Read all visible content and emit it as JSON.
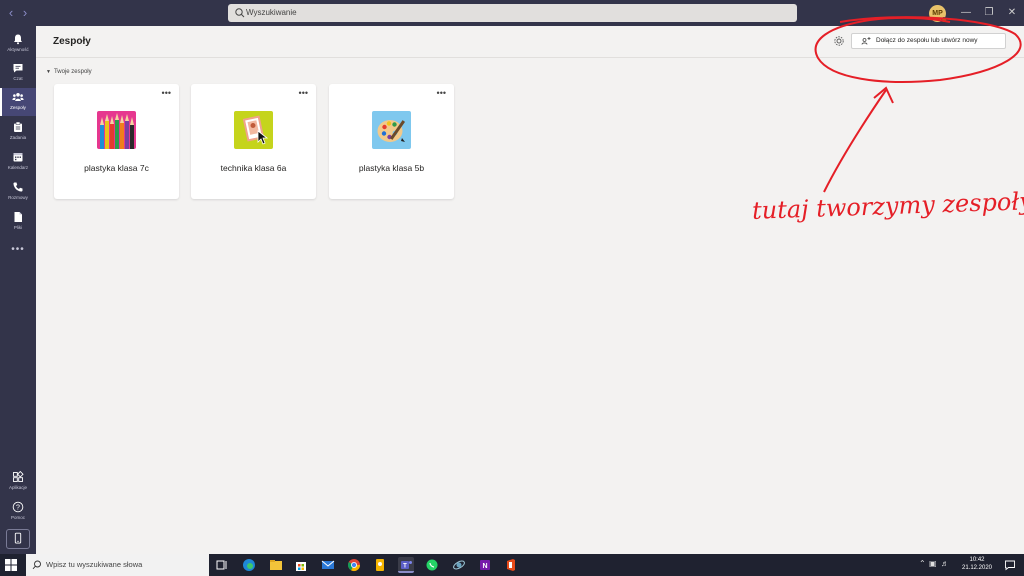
{
  "titlebar": {
    "search_placeholder": "Wyszukiwanie",
    "avatar_initials": "MP"
  },
  "rail": {
    "items": [
      {
        "label": "Aktywność",
        "icon": "bell-icon"
      },
      {
        "label": "Czat",
        "icon": "chat-icon"
      },
      {
        "label": "Zespoły",
        "icon": "teams-icon"
      },
      {
        "label": "Zadania",
        "icon": "assignments-icon"
      },
      {
        "label": "Kalendarz",
        "icon": "calendar-icon"
      },
      {
        "label": "Rozmowy",
        "icon": "phone-icon"
      },
      {
        "label": "Pliki",
        "icon": "files-icon"
      }
    ],
    "bottom": [
      {
        "label": "Aplikacje",
        "icon": "apps-icon"
      },
      {
        "label": "Pomoc",
        "icon": "help-icon"
      }
    ]
  },
  "header": {
    "title": "Zespoły",
    "join_button": "Dołącz do zespołu lub utwórz nowy"
  },
  "section": {
    "label": "Twoje zespoły"
  },
  "teams": [
    {
      "name": "plastyka klasa 7c",
      "icon": "colored-pencils-icon"
    },
    {
      "name": "technika klasa 6a",
      "icon": "picture-frame-icon"
    },
    {
      "name": "plastyka klasa 5b",
      "icon": "paint-palette-icon"
    }
  ],
  "annotation": {
    "text": "tutaj tworzymy zespoły",
    "color": "#e51f27"
  },
  "taskbar": {
    "search_placeholder": "Wpisz tu wyszukiwane słowa",
    "time": "10:42",
    "date": "21.12.2020"
  },
  "colors": {
    "rail": "#33344a",
    "accent": "#6264a7",
    "background": "#f3f2f1"
  }
}
